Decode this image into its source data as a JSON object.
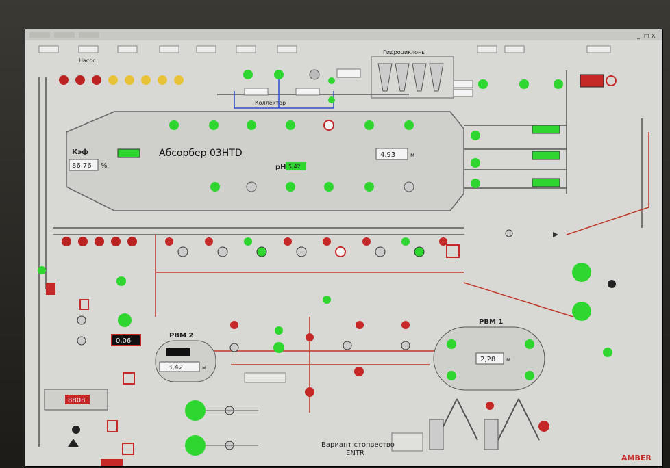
{
  "window": {
    "min_label": "_",
    "max_label": "□",
    "close_label": "X"
  },
  "pump_section": {
    "label": "Насос"
  },
  "hydrocyclones": {
    "label": "Гидроциклоны"
  },
  "absorber": {
    "title": "Абсорбер 03HTD",
    "kif_label": "Кэф",
    "kif_value": "86,76",
    "kif_unit": "%",
    "ph_label": "pH",
    "ph_value": "5,42",
    "level_value": "4,93",
    "level_unit": "м"
  },
  "header_collector": {
    "label": "Коллектор"
  },
  "pbm2": {
    "title": "РВМ 2",
    "level_value": "3,42",
    "level_unit": "м"
  },
  "pbm1": {
    "title": "РВМ 1",
    "level_value": "2,28",
    "level_unit": "м"
  },
  "red_display": {
    "value": "0,06"
  },
  "panel_display": {
    "value": "8808"
  },
  "bottom_label": {
    "line1": "Вариант стопвество",
    "line2": "ENTR"
  },
  "brand": "AMBER",
  "colors": {
    "background": "#d8d8d4",
    "active": "#2fd62f",
    "alarm": "#c62828",
    "pipe_red": "#c0392b",
    "pipe_blue": "#2c4ccf",
    "pipe_dark": "#555555",
    "yellow": "#e8c33a"
  }
}
